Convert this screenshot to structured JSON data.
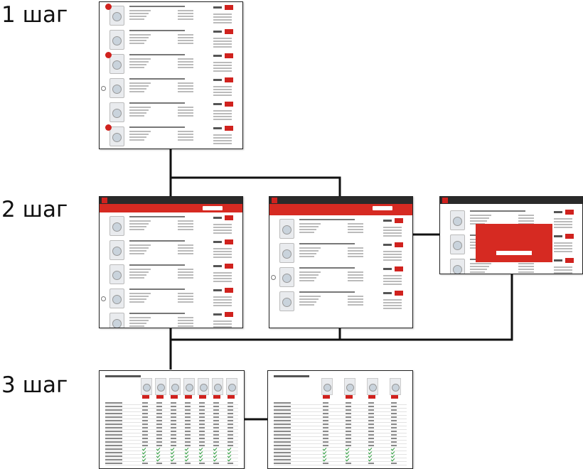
{
  "steps": [
    {
      "label": "1 шаг"
    },
    {
      "label": "2 шаг"
    },
    {
      "label": "3 шаг"
    }
  ],
  "colors": {
    "accent": "#d0221e",
    "connector": "#111111",
    "header": "#2a2a2a"
  }
}
